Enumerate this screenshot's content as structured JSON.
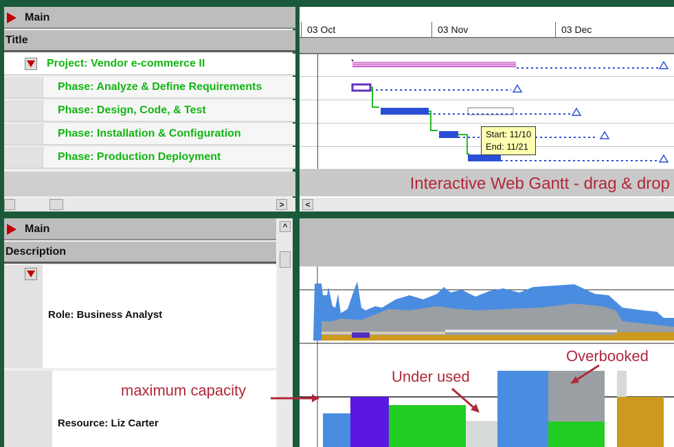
{
  "top_grid": {
    "main_label": "Main",
    "title_label": "Title",
    "rows": [
      {
        "label": "Project: Vendor e-commerce II",
        "type": "project"
      },
      {
        "label": "Phase: Analyze & Define Requirements",
        "type": "phase"
      },
      {
        "label": "Phase: Design, Code, & Test",
        "type": "phase"
      },
      {
        "label": "Phase: Installation & Configuration",
        "type": "phase"
      },
      {
        "label": "Phase: Production Deployment",
        "type": "phase"
      }
    ],
    "scroll_right": ">",
    "scroll_left": "<"
  },
  "gantt": {
    "dates": [
      "03 Oct",
      "03 Nov",
      "03 Dec"
    ],
    "tooltip": {
      "start": "Start: 11/10",
      "end": "End: 11/21"
    },
    "banner": "Interactive Web Gantt - drag & drop",
    "colors": {
      "project_bar": "#cc66cc",
      "phase_bar": "#2a4fd6",
      "dependency": "#22bb22",
      "milestone": "#2a4fd6"
    }
  },
  "bottom_grid": {
    "main_label": "Main",
    "description_label": "Description",
    "role_label": "Role: Business Analyst",
    "resource_label": "Resource: Liz Carter",
    "scroll_up": "^"
  },
  "annotations": {
    "max_capacity": "maximum capacity",
    "under_used": "Under used",
    "overbooked": "Overbooked"
  },
  "colors": {
    "annotation": "#b0283a",
    "phase_text": "#12b512",
    "expand_icon": "#c00000"
  }
}
